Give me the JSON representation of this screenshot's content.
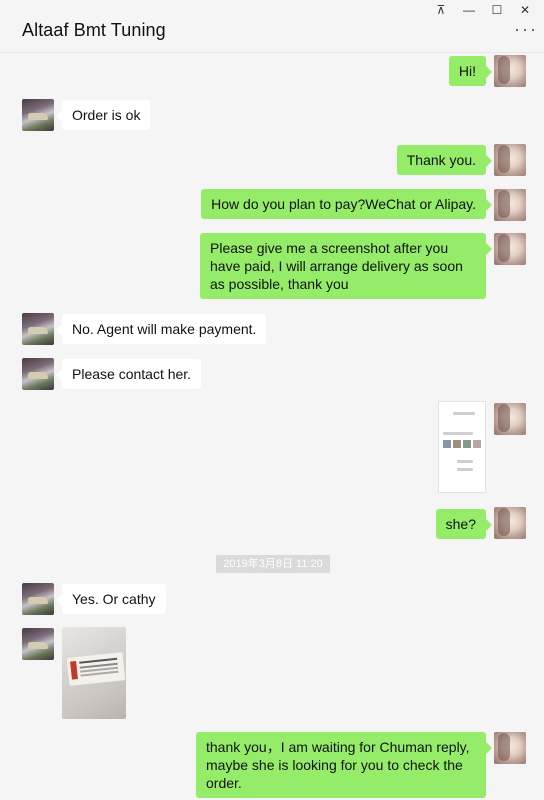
{
  "window": {
    "title": "Altaaf Bmt Tuning",
    "controls": {
      "pin": "⊼",
      "minimize": "—",
      "maximize": "☐",
      "close": "✕",
      "more": "···"
    }
  },
  "messages": [
    {
      "side": "out",
      "type": "text",
      "text": "Hi!"
    },
    {
      "side": "in",
      "type": "text",
      "text": "Order is ok"
    },
    {
      "side": "out",
      "type": "text",
      "text": "Thank you."
    },
    {
      "side": "out",
      "type": "text",
      "text": "How do you plan to pay?WeChat or Alipay."
    },
    {
      "side": "out",
      "type": "text",
      "text": "Please give me a screenshot after you have paid, I will arrange delivery as soon as possible, thank you"
    },
    {
      "side": "in",
      "type": "text",
      "text": "No. Agent will make payment."
    },
    {
      "side": "in",
      "type": "text",
      "text": "Please contact her."
    },
    {
      "side": "out",
      "type": "image",
      "text": ""
    },
    {
      "side": "out",
      "type": "text",
      "text": "she?"
    },
    {
      "side": "system",
      "type": "timestamp",
      "text": "2019年3月8日 11:20"
    },
    {
      "side": "in",
      "type": "text",
      "text": "Yes. Or cathy"
    },
    {
      "side": "in",
      "type": "image",
      "text": ""
    },
    {
      "side": "out",
      "type": "text",
      "text": "thank you，I am waiting for Chuman reply, maybe she is looking for you to check the order."
    }
  ],
  "colors": {
    "outgoing_bubble": "#95ec69",
    "incoming_bubble": "#ffffff",
    "background": "#f5f5f5"
  },
  "icons": {
    "contact_avatar": "car-photo-avatar",
    "self_avatar": "portrait-avatar"
  }
}
